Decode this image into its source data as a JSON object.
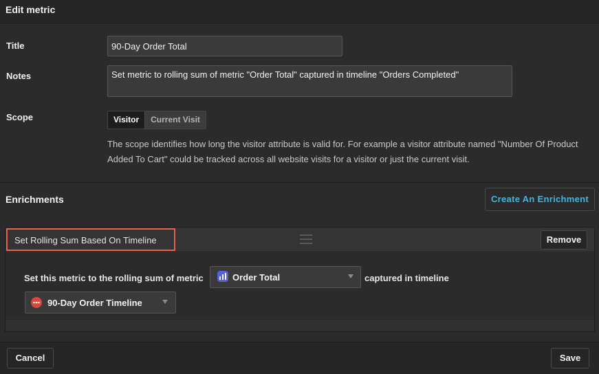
{
  "header": {
    "title": "Edit metric"
  },
  "form": {
    "title_label": "Title",
    "title_value": "90-Day Order Total",
    "notes_label": "Notes",
    "notes_value": "Set metric to rolling sum of metric \"Order Total\" captured in timeline \"Orders Completed\"",
    "scope_label": "Scope",
    "scope_options": [
      "Visitor",
      "Current Visit"
    ],
    "scope_selected": "Visitor",
    "scope_help": "The scope identifies how long the visitor attribute is valid for. For example a visitor attribute named \"Number Of Product Added To Cart\" could be tracked across all website visits for a visitor or just the current visit."
  },
  "enrichments": {
    "heading": "Enrichments",
    "create_label": "Create An Enrichment",
    "items": [
      {
        "title": "Set Rolling Sum Based On Timeline",
        "remove_label": "Remove",
        "prefix_text": "Set this metric to the rolling sum of metric",
        "metric_select": {
          "value": "Order Total",
          "icon": "bar-chart-icon",
          "color": "#5b5fd6"
        },
        "middle_text": "captured in timeline",
        "timeline_select": {
          "value": "90-Day Order Timeline",
          "icon": "timeline-dots-icon",
          "color": "#d6493e"
        }
      }
    ]
  },
  "footer": {
    "cancel_label": "Cancel",
    "save_label": "Save"
  },
  "colors": {
    "accent": "#3ab8e8",
    "highlight": "#e8604c"
  }
}
